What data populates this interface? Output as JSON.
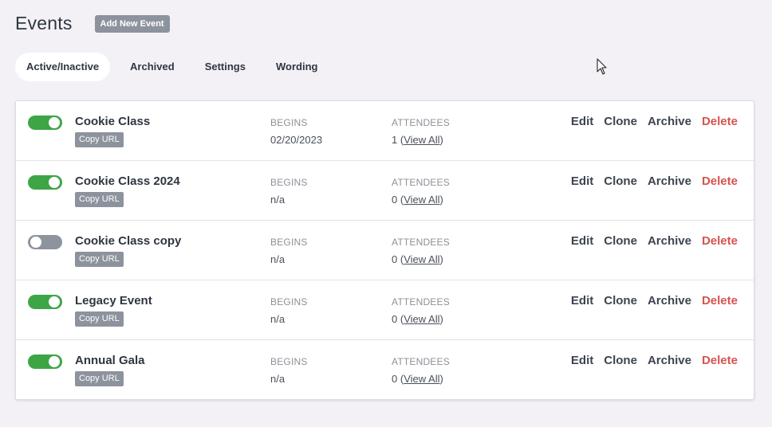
{
  "header": {
    "title": "Events",
    "add_button": "Add New Event"
  },
  "tabs": [
    {
      "label": "Active/Inactive",
      "active": true
    },
    {
      "label": "Archived",
      "active": false
    },
    {
      "label": "Settings",
      "active": false
    },
    {
      "label": "Wording",
      "active": false
    }
  ],
  "columns": {
    "begins": "BEGINS",
    "attendees": "ATTENDEES"
  },
  "copy_url_label": "Copy URL",
  "view_all_label": "View All",
  "actions": {
    "edit": "Edit",
    "clone": "Clone",
    "archive": "Archive",
    "delete": "Delete"
  },
  "events": [
    {
      "name": "Cookie Class",
      "active": true,
      "begins": "02/20/2023",
      "attendees": "1"
    },
    {
      "name": "Cookie Class 2024",
      "active": true,
      "begins": "n/a",
      "attendees": "0"
    },
    {
      "name": "Cookie Class copy",
      "active": false,
      "begins": "n/a",
      "attendees": "0"
    },
    {
      "name": "Legacy Event",
      "active": true,
      "begins": "n/a",
      "attendees": "0"
    },
    {
      "name": "Annual Gala",
      "active": true,
      "begins": "n/a",
      "attendees": "0"
    }
  ],
  "colors": {
    "toggle_on": "#3ea546",
    "toggle_off": "#8e949e",
    "delete": "#d5534f",
    "badge": "#8d939d",
    "background": "#f3f1f6"
  },
  "icons": [
    "mouse-cursor-icon"
  ]
}
